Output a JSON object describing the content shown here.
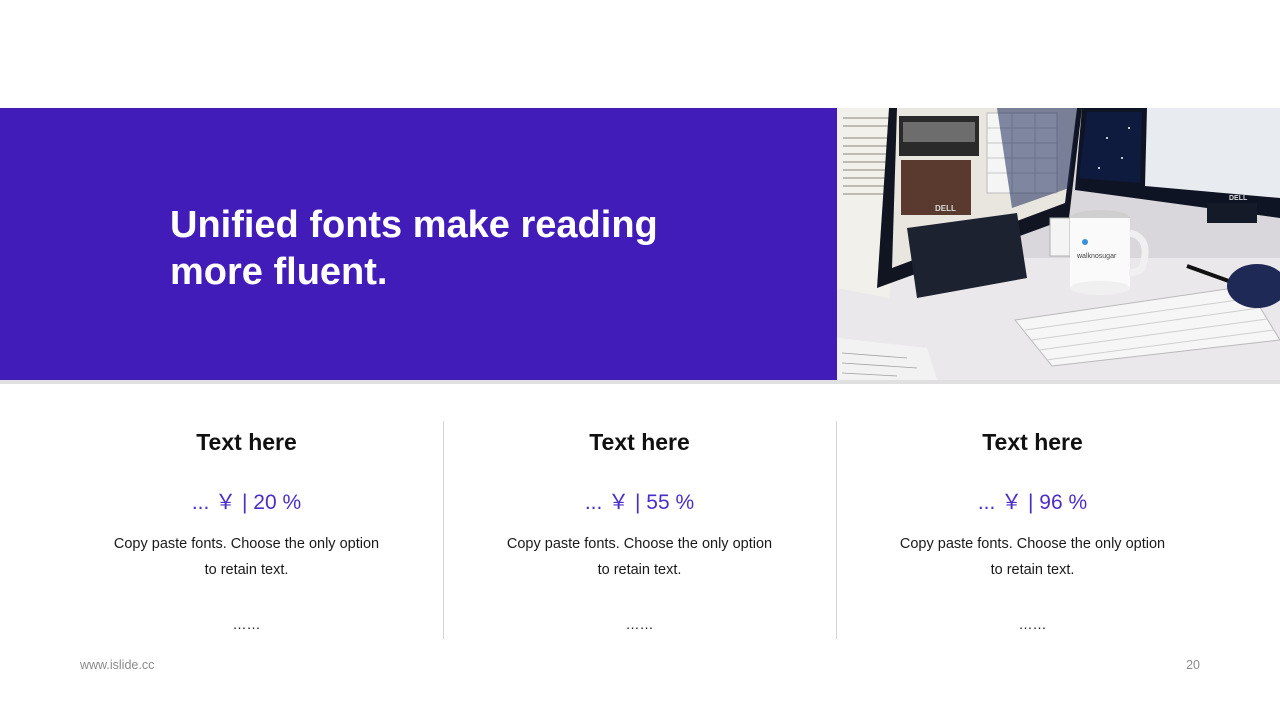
{
  "banner": {
    "title_line1": "Unified fonts make reading",
    "title_line2": "more fluent.",
    "bg_color": "#411cb9"
  },
  "photo": {
    "description_icon": "desk-photo-image",
    "mug_text": "walknosugar",
    "monitor_brand": "DELL"
  },
  "columns": [
    {
      "title": "Text here",
      "value": "... ￥ | 20 %",
      "desc_line1": "Copy paste fonts. Choose the only option",
      "desc_line2": "to retain text.",
      "more": "……"
    },
    {
      "title": "Text here",
      "value": "... ￥ | 55 %",
      "desc_line1": "Copy paste fonts. Choose the only option",
      "desc_line2": "to retain text.",
      "more": "……"
    },
    {
      "title": "Text here",
      "value": "... ￥ | 96 %",
      "desc_line1": "Copy paste fonts. Choose the only option",
      "desc_line2": "to retain text.",
      "more": "……"
    }
  ],
  "footer": {
    "url": "www.islide.cc",
    "page_number": "20"
  },
  "accent_color": "#4a2ec8"
}
